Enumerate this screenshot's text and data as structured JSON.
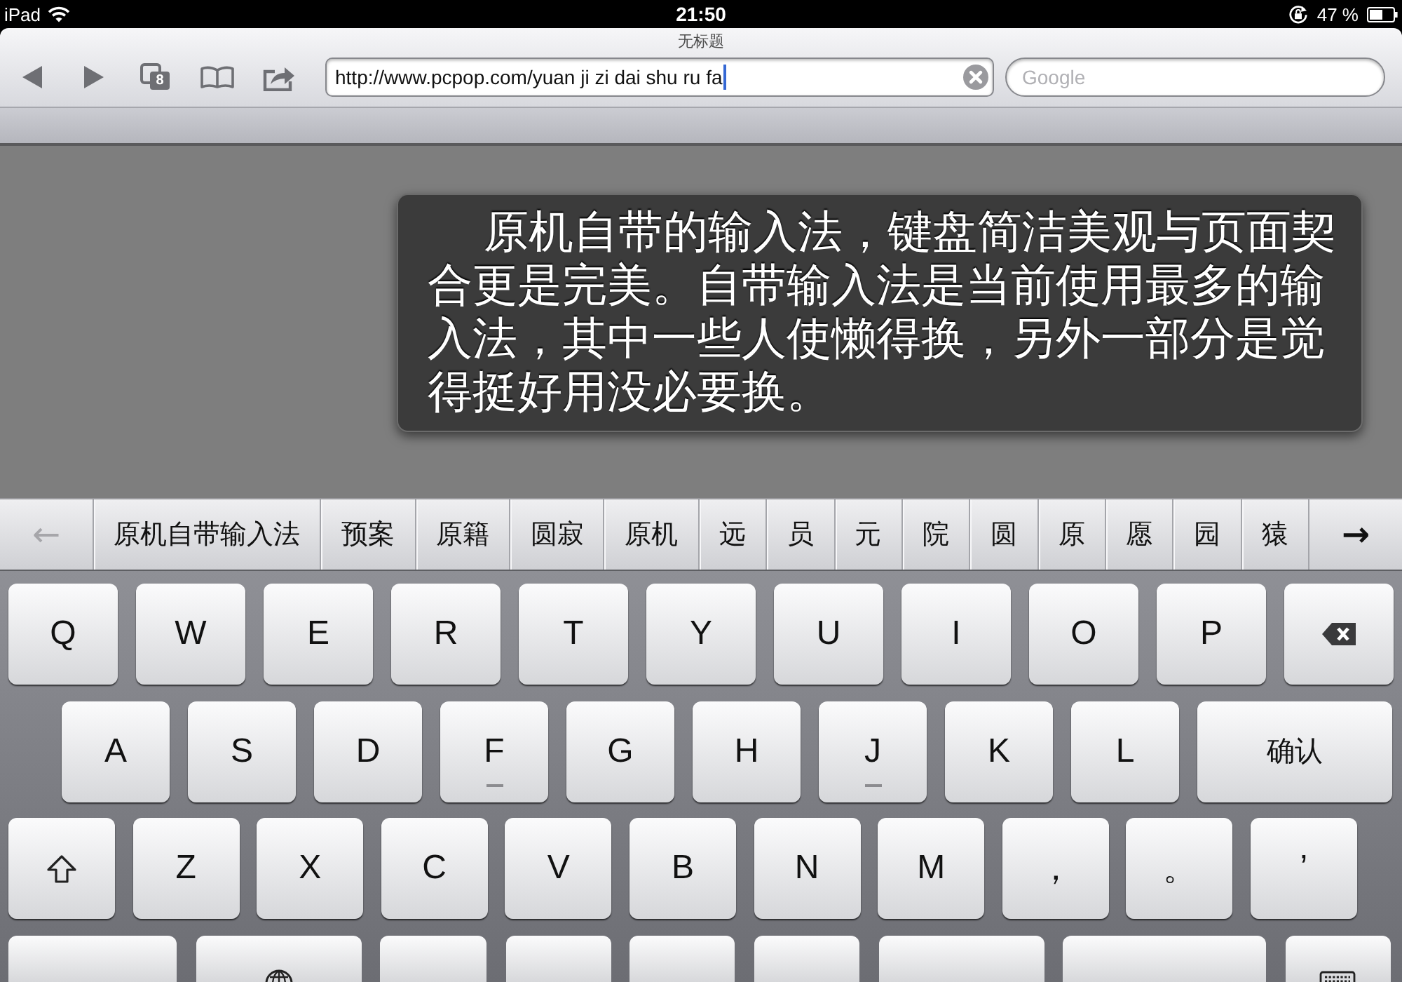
{
  "status_bar": {
    "device": "iPad",
    "time": "21:50",
    "battery": "47 %"
  },
  "browser": {
    "title": "无标题",
    "tab_count": "8",
    "url": {
      "value": "http://www.pcpop.com/yuan ji zi dai shu ru fa",
      "focused": true
    },
    "search": {
      "placeholder": "Google"
    }
  },
  "page": {
    "caption": "原机自带的输入法，键盘简洁美观与页面契合更是完美。自带输入法是当前使用最多的输入法，其中一些人使懒得换，另外一部分是觉得挺好用没必要换。"
  },
  "candidate_bar": {
    "prev": {
      "label": "←",
      "disabled": true
    },
    "candidates": [
      {
        "label": "原机自带输入法"
      },
      {
        "label": "预案"
      },
      {
        "label": "原籍"
      },
      {
        "label": "圆寂"
      },
      {
        "label": "原机"
      },
      {
        "label": "远"
      },
      {
        "label": "员"
      },
      {
        "label": "元"
      },
      {
        "label": "院"
      },
      {
        "label": "圆"
      },
      {
        "label": "原"
      },
      {
        "label": "愿"
      },
      {
        "label": "园"
      },
      {
        "label": "猿"
      }
    ],
    "next": {
      "label": "→",
      "disabled": false
    }
  },
  "keyboard": {
    "rows": [
      {
        "keys": [
          {
            "kind": "char",
            "label": "Q"
          },
          {
            "kind": "char",
            "label": "W"
          },
          {
            "kind": "char",
            "label": "E"
          },
          {
            "kind": "char",
            "label": "R"
          },
          {
            "kind": "char",
            "label": "T"
          },
          {
            "kind": "char",
            "label": "Y"
          },
          {
            "kind": "char",
            "label": "U"
          },
          {
            "kind": "char",
            "label": "I"
          },
          {
            "kind": "char",
            "label": "O"
          },
          {
            "kind": "char",
            "label": "P"
          },
          {
            "kind": "backspace"
          }
        ]
      },
      {
        "keys": [
          {
            "kind": "char",
            "label": "A",
            "bump": false
          },
          {
            "kind": "char",
            "label": "S",
            "bump": false
          },
          {
            "kind": "char",
            "label": "D",
            "bump": false
          },
          {
            "kind": "char",
            "label": "F",
            "bump": true
          },
          {
            "kind": "char",
            "label": "G",
            "bump": false
          },
          {
            "kind": "char",
            "label": "H",
            "bump": false
          },
          {
            "kind": "char",
            "label": "J",
            "bump": true
          },
          {
            "kind": "char",
            "label": "K",
            "bump": false
          },
          {
            "kind": "char",
            "label": "L",
            "bump": false
          },
          {
            "kind": "enter",
            "label": "确认",
            "bump": false
          }
        ]
      },
      {
        "keys": [
          {
            "kind": "shift"
          },
          {
            "kind": "char",
            "label": "Z"
          },
          {
            "kind": "char",
            "label": "X"
          },
          {
            "kind": "char",
            "label": "C"
          },
          {
            "kind": "char",
            "label": "V"
          },
          {
            "kind": "char",
            "label": "B"
          },
          {
            "kind": "char",
            "label": "N"
          },
          {
            "kind": "char",
            "label": "M"
          },
          {
            "kind": "char",
            "label": "，"
          },
          {
            "kind": "char",
            "label": "。"
          },
          {
            "kind": "char",
            "label": "’"
          }
        ]
      },
      {
        "keys": [
          {
            "kind": "blank"
          },
          {
            "kind": "globe"
          },
          {
            "kind": "blank"
          },
          {
            "kind": "blank"
          },
          {
            "kind": "blank"
          },
          {
            "kind": "blank"
          },
          {
            "kind": "blank"
          },
          {
            "kind": "blank"
          },
          {
            "kind": "hide"
          }
        ]
      }
    ]
  }
}
